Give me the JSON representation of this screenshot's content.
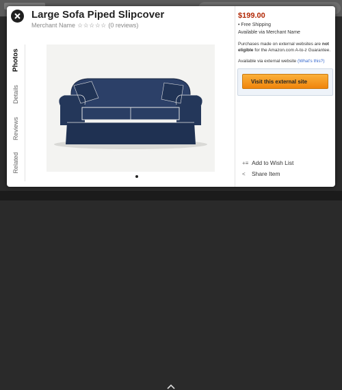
{
  "product": {
    "title": "Large Sofa Piped Slipcover",
    "merchant": "Merchant Name",
    "stars": "☆☆☆☆☆",
    "reviews": "(0 reviews)"
  },
  "tabs": [
    "Photos",
    "Details",
    "Reviews",
    "Related"
  ],
  "active_tab": "Photos",
  "buy": {
    "price": "$199.00",
    "shipping": "• Free Shipping",
    "availability": "Available via Merchant Name",
    "notice_prefix": "Purchases made on external websites are ",
    "notice_bold": "not eligible",
    "notice_suffix": " for the Amazon.com A-to-z Guarantee.",
    "external_label": "Available via external website",
    "whats_this": "(What's this?)",
    "visit_button": "Visit this external site"
  },
  "actions": {
    "wishlist": "Add to Wish List",
    "share": "Share Item"
  },
  "icons": {
    "close": "close-icon",
    "wishlist": "wishlist-icon",
    "share": "share-icon",
    "chevron": "chevron-up-icon"
  },
  "colors": {
    "price": "#b12704",
    "button": "#f0850b",
    "sofa": "#24375a",
    "link": "#3366cc"
  }
}
